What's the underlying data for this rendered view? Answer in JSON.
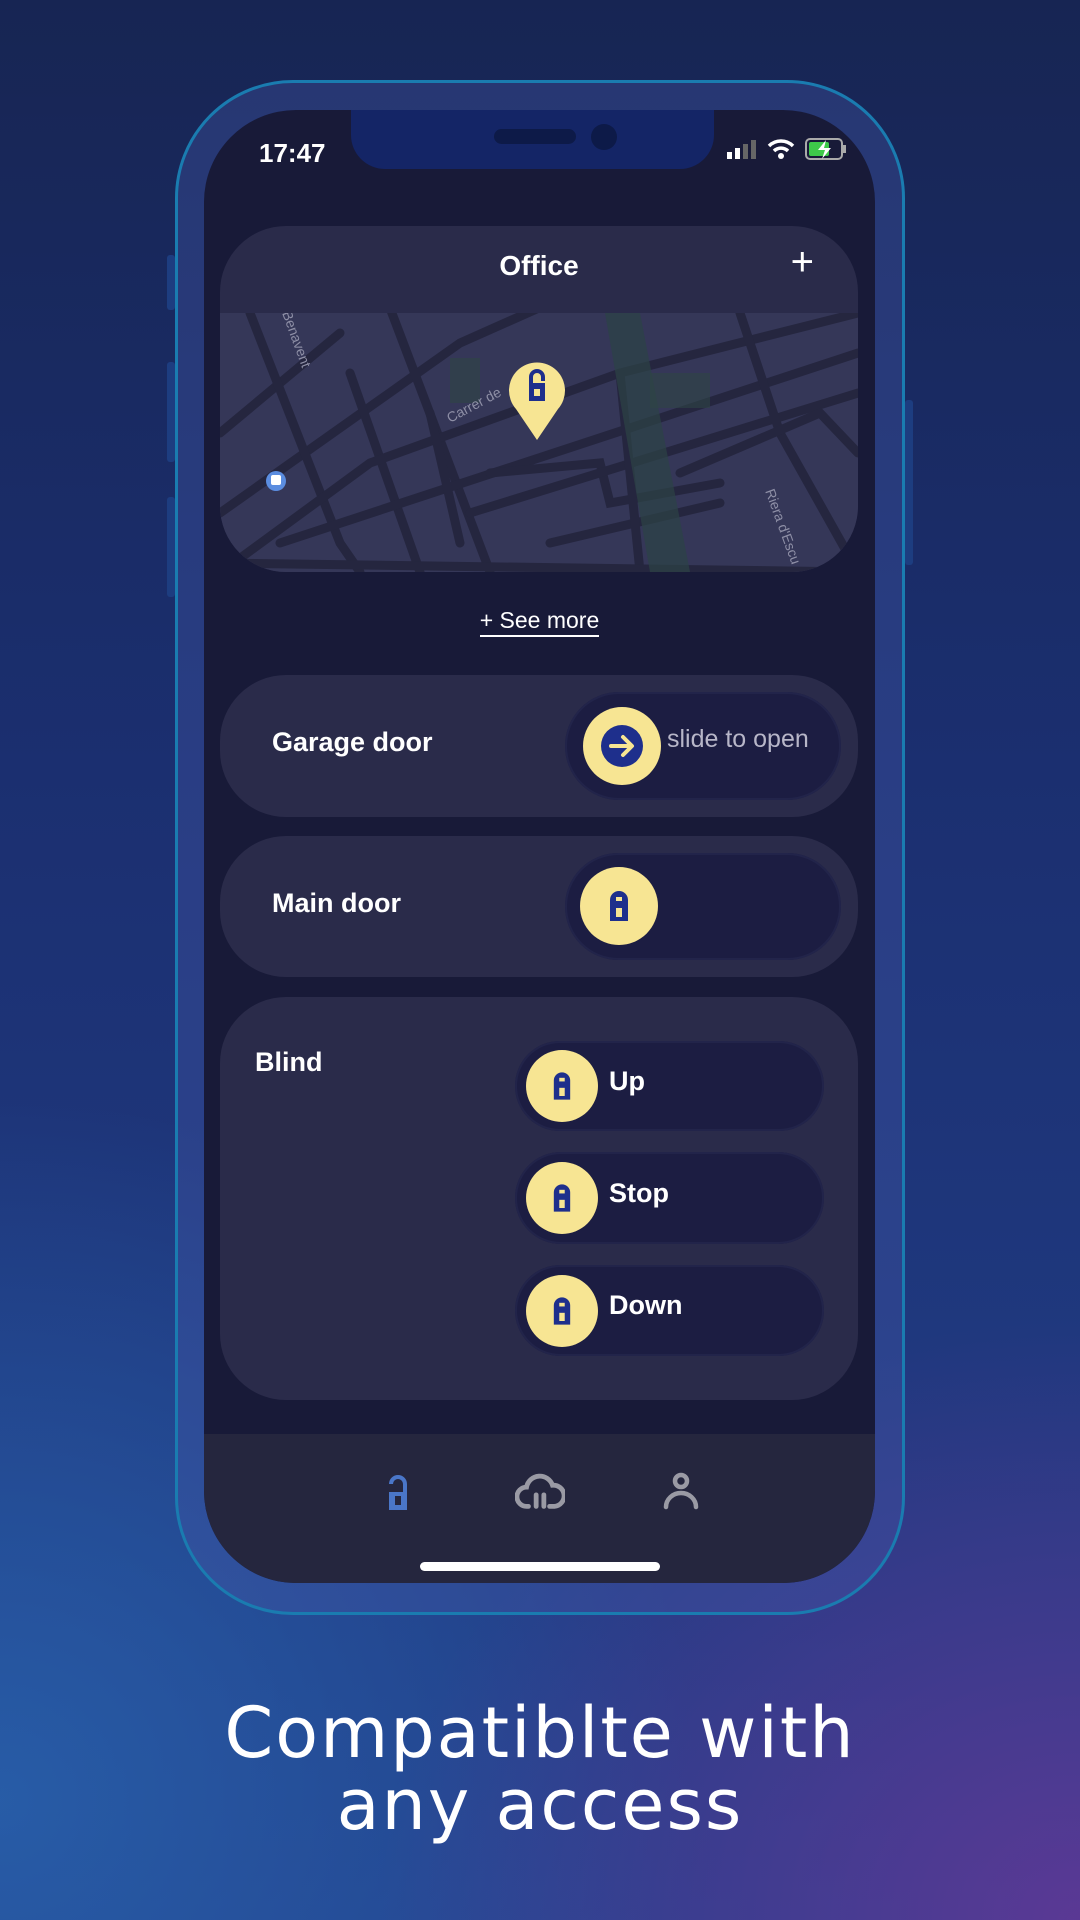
{
  "status_bar": {
    "time": "17:47",
    "icons": [
      "signal-icon",
      "wifi-icon",
      "battery-charging-icon"
    ]
  },
  "office_card": {
    "title": "Office",
    "add_label": "+",
    "map_labels": [
      "Benavent",
      "Carrer de",
      "Riera d'Escu"
    ],
    "pin_icon": "lock-open-pin-icon"
  },
  "see_more": "+ See more",
  "garage": {
    "label": "Garage door",
    "slider_text": "slide to open",
    "knob_icon": "arrow-right-icon"
  },
  "main_door": {
    "label": "Main door",
    "knob_icon": "lock-icon"
  },
  "blind": {
    "label": "Blind",
    "buttons": [
      {
        "label": "Up"
      },
      {
        "label": "Stop"
      },
      {
        "label": "Down"
      }
    ]
  },
  "tabbar": {
    "items": [
      {
        "icon": "lock-open-icon",
        "active": true
      },
      {
        "icon": "cloud-icon",
        "active": false
      },
      {
        "icon": "user-icon",
        "active": false
      }
    ]
  },
  "colors": {
    "accent": "#f7e593",
    "icon_blue": "#1e2f8c",
    "tab_active": "#4a76c8",
    "tab_inactive": "#9a9aa4"
  },
  "caption": {
    "line1": "Compatiblte with",
    "line2": "any access"
  }
}
